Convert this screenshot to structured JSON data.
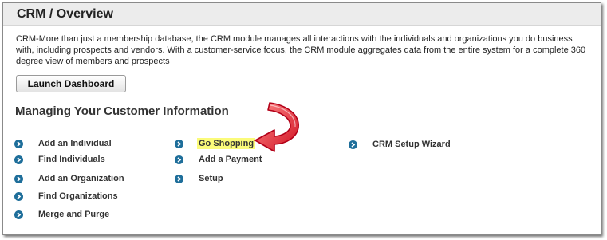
{
  "header": {
    "title": "CRM / Overview"
  },
  "intro": {
    "text": "CRM-More than just a membership database, the CRM module manages all interactions with the individuals and organizations you do business with, including prospects and vendors. With a customer-service focus, the CRM module aggregates data from the entire system for a complete 360 degree view of members and prospects"
  },
  "launch_button": {
    "label": "Launch Dashboard"
  },
  "section": {
    "title": "Managing Your Customer Information"
  },
  "links": {
    "col1": [
      "Add an Individual",
      "Find Individuals",
      "Add an Organization",
      "Find Organizations",
      "Merge and Purge"
    ],
    "col2": [
      "Go Shopping",
      "Add a Payment",
      "Setup"
    ],
    "col3": [
      "CRM Setup Wizard"
    ]
  },
  "colors": {
    "bullet": "#1e6e9a",
    "highlight": "#fbfb7a",
    "arrow": "#cc1122"
  },
  "icons": {
    "bullet": "circle-chevron-right-icon",
    "annotation": "curved-red-arrow-icon"
  }
}
